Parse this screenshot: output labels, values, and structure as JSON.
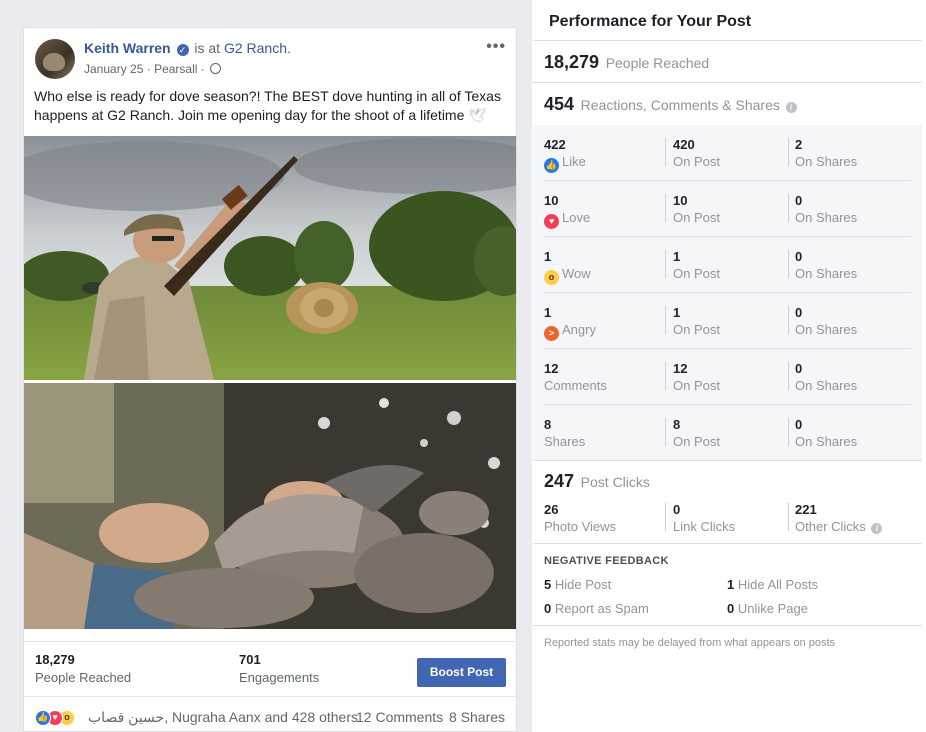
{
  "post": {
    "author": "Keith Warren",
    "is_at": "is at",
    "place": "G2 Ranch.",
    "date": "January 25",
    "location": "Pearsall",
    "meta_sep": "·",
    "text": "Who else is ready for dove season?! The BEST dove hunting in all of Texas happens at G2 Ranch. Join me opening day for the shoot of a lifetime",
    "emoji": "🕊",
    "reached_num": "18,279",
    "reached_label": "People Reached",
    "engagements_num": "701",
    "engagements_label": "Engagements",
    "boost_label": "Boost Post",
    "reactors": "حسين قصاب, Nugraha Aanx and 428 others",
    "comments": "12 Comments",
    "shares": "8 Shares"
  },
  "performance": {
    "title": "Performance for Your Post",
    "people_reached_num": "18,279",
    "people_reached_label": "People Reached",
    "rcs_num": "454",
    "rcs_label": "Reactions, Comments & Shares",
    "rows": [
      {
        "icon": "like-icon",
        "total": "422",
        "label": "Like",
        "on_post": "420",
        "on_post_label": "On Post",
        "on_shares": "2",
        "on_shares_label": "On Shares"
      },
      {
        "icon": "love-icon",
        "total": "10",
        "label": "Love",
        "on_post": "10",
        "on_post_label": "On Post",
        "on_shares": "0",
        "on_shares_label": "On Shares"
      },
      {
        "icon": "wow-icon",
        "total": "1",
        "label": "Wow",
        "on_post": "1",
        "on_post_label": "On Post",
        "on_shares": "0",
        "on_shares_label": "On Shares"
      },
      {
        "icon": "angry-icon",
        "total": "1",
        "label": "Angry",
        "on_post": "1",
        "on_post_label": "On Post",
        "on_shares": "0",
        "on_shares_label": "On Shares"
      },
      {
        "icon": "",
        "total": "12",
        "label": "Comments",
        "on_post": "12",
        "on_post_label": "On Post",
        "on_shares": "0",
        "on_shares_label": "On Shares"
      },
      {
        "icon": "",
        "total": "8",
        "label": "Shares",
        "on_post": "8",
        "on_post_label": "On Post",
        "on_shares": "0",
        "on_shares_label": "On Shares"
      }
    ],
    "post_clicks_num": "247",
    "post_clicks_label": "Post Clicks",
    "photo_views_num": "26",
    "photo_views_label": "Photo Views",
    "link_clicks_num": "0",
    "link_clicks_label": "Link Clicks",
    "other_clicks_num": "221",
    "other_clicks_label": "Other Clicks",
    "negative_title": "NEGATIVE FEEDBACK",
    "hide_post_num": "5",
    "hide_post_label": "Hide Post",
    "hide_all_num": "1",
    "hide_all_label": "Hide All Posts",
    "spam_num": "0",
    "spam_label": "Report as Spam",
    "unlike_num": "0",
    "unlike_label": "Unlike Page",
    "footnote": "Reported stats may be delayed from what appears on posts"
  },
  "colors": {
    "brand": "#4267b2",
    "link": "#385898",
    "like": "#2078f4",
    "love": "#f33e58",
    "wow": "#fccc4a",
    "angry": "#f0632a"
  }
}
